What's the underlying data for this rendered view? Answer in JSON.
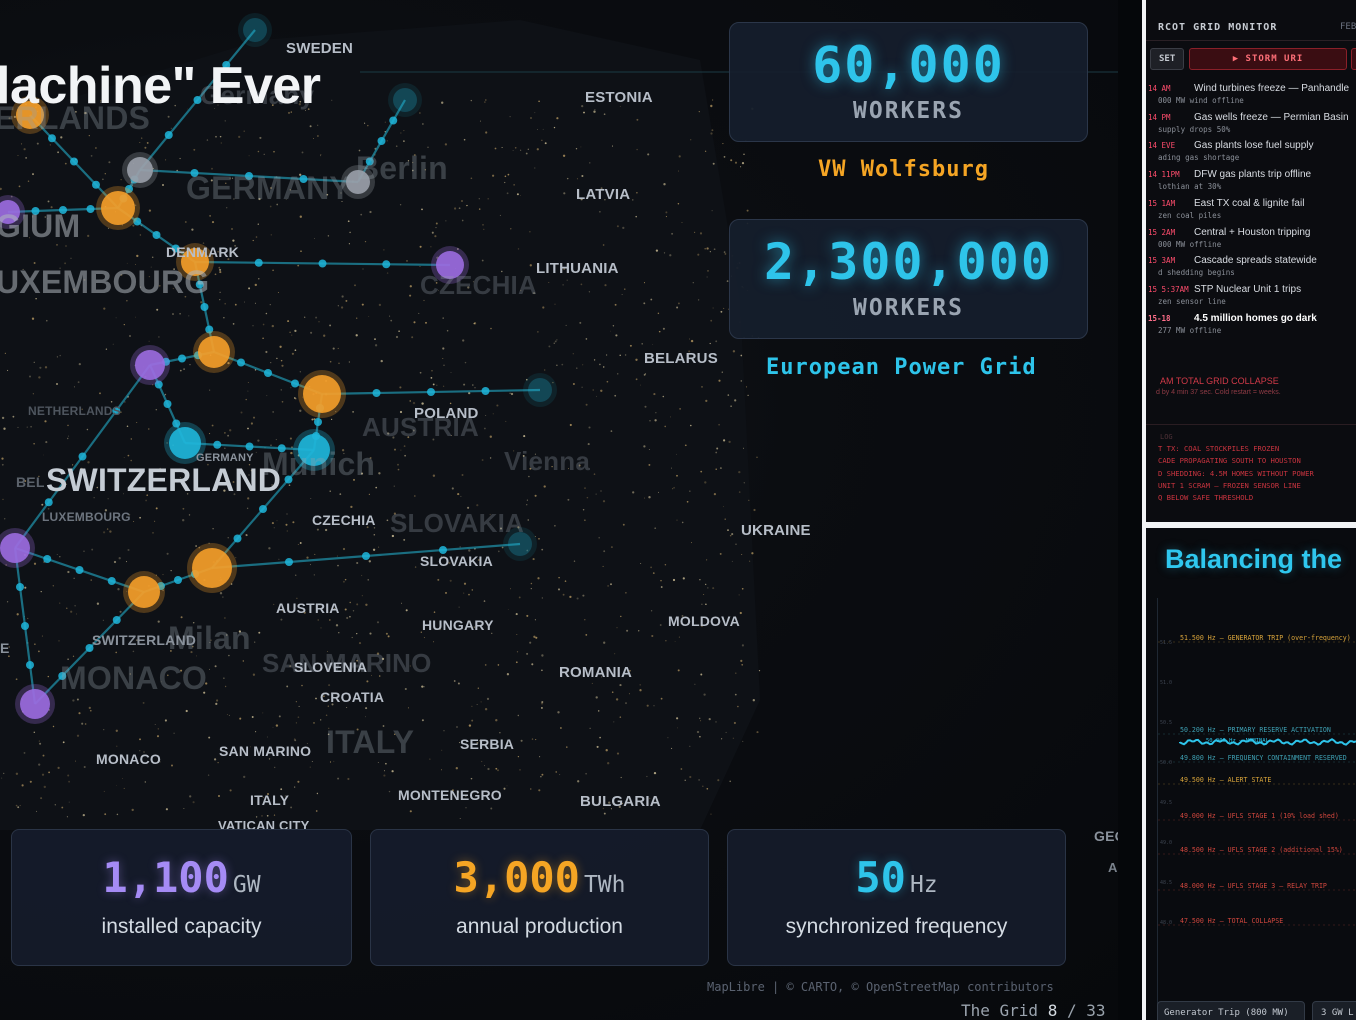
{
  "map": {
    "title_fragment": "lachine\" Ever",
    "labels": {
      "sweden": "SWEDEN",
      "estonia": "ESTONIA",
      "latvia": "LATVIA",
      "lithuania": "LITHUANIA",
      "belarus": "BELARUS",
      "poland": "POLAND",
      "ukraine": "UKRAINE",
      "czechia": "CZECHIA",
      "slovakia": "SLOVAKIA",
      "austria": "AUSTRIA",
      "hungary": "HUNGARY",
      "moldova": "MOLDOVA",
      "romania": "ROMANIA",
      "slovenia": "SLOVENIA",
      "croatia": "CROATIA",
      "serbia": "SERBIA",
      "bulgaria": "BULGARIA",
      "montenegro": "MONTENEGRO",
      "san_marino": "SAN MARINO",
      "monaco": "MONACO",
      "italy": "ITALY",
      "vatican": "VATICAN CITY",
      "denmark": "DENMARK",
      "germany_small": "GERMANY",
      "luxembourg_small": "LUXEMBOURG",
      "switzerland_small": "SWITZERLAND",
      "netherlands_small": "NETHERLANDS",
      "switzerland_big": "SWITZERLAND",
      "germany_ghost": "GERMANY",
      "berlin_ghost": "Berlin",
      "czechia_ghost": "CZECHIA",
      "austria_ghost": "AUSTRIA",
      "munich_ghost": "Munich",
      "vienna_ghost": "Vienna",
      "slovakia_ghost": "SLOVAKIA",
      "milan_ghost": "Milan",
      "monaco_ghost": "MONACO",
      "italy_ghost": "ITALY",
      "sanmarino_ghost": "SAN MARINO",
      "belgium_ghost": "GIUM",
      "luxembourg_ghost": "UXEMBOURG",
      "netherlands_ghost": "ERLANDS",
      "germany_ghost2": "Germany",
      "geo_edge": "GEO",
      "e_edge": "E",
      "bel_edge": "BEL",
      "ka_edge": "A"
    },
    "attribution": "MapLibre | © CARTO, © OpenStreetMap contributors",
    "pager": {
      "name": "The Grid",
      "current": "8",
      "sep": "/",
      "total": "33"
    }
  },
  "stats": {
    "vw_workers": {
      "value": "60,000",
      "unit": "WORKERS",
      "label": "VW Wolfsburg"
    },
    "grid_workers": {
      "value": "2,300,000",
      "unit": "WORKERS",
      "label": "European Power Grid"
    }
  },
  "bottom_cards": [
    {
      "value": "1,100",
      "unit": "GW",
      "label": "installed capacity",
      "color": "#a58bf5"
    },
    {
      "value": "3,000",
      "unit": "TWh",
      "label": "annual production",
      "color": "#f5a524"
    },
    {
      "value": "50",
      "unit": "Hz",
      "label": "synchronized frequency",
      "color": "#2ec4ea"
    }
  ],
  "colors": {
    "accent_cyan": "#2ec4ea",
    "accent_orange": "#f5a524",
    "accent_purple": "#a58bf5",
    "alert_red": "#ff4d6d"
  },
  "ercot": {
    "title": "RCOT GRID MONITOR",
    "date": "FEB",
    "reset_label": "SET",
    "storm_label": "▶ STORM URI",
    "events": [
      {
        "time": "14 AM",
        "text": "Wind turbines freeze — Panhandle",
        "sub": "000 MW wind offline"
      },
      {
        "time": "14 PM",
        "text": "Gas wells freeze — Permian Basin",
        "sub": "supply drops 50%"
      },
      {
        "time": "14 EVE",
        "text": "Gas plants lose fuel supply",
        "sub": "ading gas shortage"
      },
      {
        "time": "14 11PM",
        "text": "DFW gas plants trip offline",
        "sub": "lothian at 30%"
      },
      {
        "time": "15 1AM",
        "text": "East TX coal & lignite fail",
        "sub": "zen coal piles"
      },
      {
        "time": "15 2AM",
        "text": "Central + Houston tripping",
        "sub": "000 MW offline"
      },
      {
        "time": "15 3AM",
        "text": "Cascade spreads statewide",
        "sub": "d shedding begins"
      },
      {
        "time": "15 5:37AM",
        "text": "STP Nuclear Unit 1 trips",
        "sub": "zen sensor line"
      },
      {
        "time": "15-18",
        "text": "4.5 million homes go dark",
        "sub": "277 MW offline"
      }
    ],
    "collapse_title": "AM TOTAL GRID COLLAPSE",
    "collapse_sub": "d by 4 min 37 sec. Cold restart = weeks.",
    "log_label": "LOG",
    "log_lines": [
      "T TX: COAL STOCKPILES FROZEN",
      "CADE PROPAGATING SOUTH TO HOUSTON",
      "D SHEDDING: 4.5M HOMES WITHOUT POWER",
      " UNIT 1 SCRAM — FROZEN SENSOR LINE",
      "Q BELOW SAFE THRESHOLD"
    ]
  },
  "balancing": {
    "title": "Balancing the",
    "thresholds": [
      {
        "text": "51.500 Hz — GENERATOR TRIP (over-frequency)",
        "color": "#d7a33a"
      },
      {
        "text": "50.200 Hz — PRIMARY RESERVE ACTIVATION",
        "color": "#3ea0b3"
      },
      {
        "text": "49.800 Hz — FREQUENCY CONTAINMENT RESERVED",
        "color": "#3ea0b3"
      },
      {
        "text": "49.500 Hz — ALERT STATE",
        "color": "#d7a33a"
      },
      {
        "text": "49.000 Hz — UFLS STAGE 1 (10% load shed)",
        "color": "#d1473e"
      },
      {
        "text": "48.500 Hz — UFLS STAGE 2 (additional 15%)",
        "color": "#d1473e"
      },
      {
        "text": "48.000 Hz — UFLS STAGE 3 — RELAY TRIP",
        "color": "#d1473e"
      },
      {
        "text": "47.500 Hz — TOTAL COLLAPSE",
        "color": "#d1473e"
      }
    ],
    "y_ticks": [
      "51.5",
      "51.0",
      "50.5",
      "50.0",
      "49.5",
      "49.0",
      "48.5",
      "48.0"
    ],
    "inline_label": "50.000 Hz — NOMINAL",
    "gen_button": "Generator Trip (800 MW)",
    "gw_button": "3 GW L"
  }
}
